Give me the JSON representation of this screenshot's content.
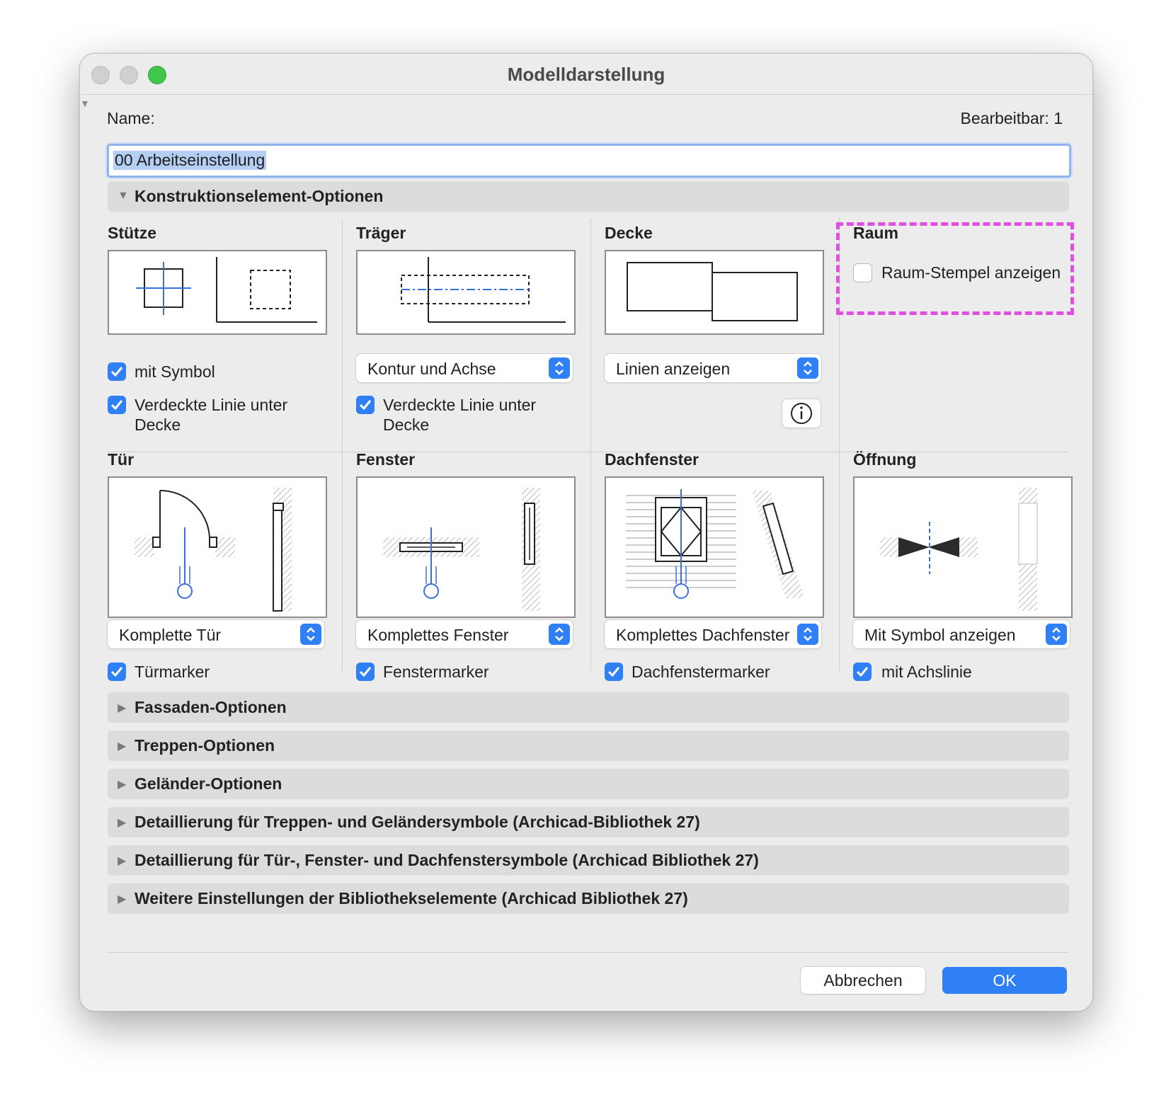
{
  "window": {
    "title": "Modelldarstellung"
  },
  "name_row": {
    "label": "Name:",
    "editable": "Bearbeitbar: 1",
    "value": "00 Arbeitseinstellung"
  },
  "construction": {
    "header": "Konstruktionselement-Optionen",
    "stuetze": {
      "title": "Stütze",
      "cb1": "mit Symbol",
      "cb2_line1": "Verdeckte Linie unter",
      "cb2_line2": "Decke"
    },
    "traeger": {
      "title": "Träger",
      "popup": "Kontur und Achse",
      "cb_line1": "Verdeckte Linie unter",
      "cb_line2": "Decke"
    },
    "decke": {
      "title": "Decke",
      "popup": "Linien anzeigen"
    },
    "raum": {
      "title": "Raum",
      "cb": "Raum-Stempel anzeigen"
    },
    "tuer": {
      "title": "Tür",
      "popup": "Komplette Tür",
      "cb": "Türmarker"
    },
    "fenster": {
      "title": "Fenster",
      "popup": "Komplettes Fenster",
      "cb": "Fenstermarker"
    },
    "dachfenster": {
      "title": "Dachfenster",
      "popup": "Komplettes Dachfenster",
      "cb": "Dachfenstermarker"
    },
    "oeffnung": {
      "title": "Öffnung",
      "popup": "Mit Symbol anzeigen",
      "cb": "mit Achslinie"
    }
  },
  "sections": [
    "Fassaden-Optionen",
    "Treppen-Optionen",
    "Geländer-Optionen",
    "Detaillierung für Treppen- und Geländersymbole (Archicad-Bibliothek 27)",
    "Detaillierung für Tür-, Fenster- und Dachfenstersymbole (Archicad Bibliothek 27)",
    "Weitere Einstellungen der Bibliothekselemente (Archicad Bibliothek 27)"
  ],
  "buttons": {
    "cancel": "Abbrechen",
    "ok": "OK"
  },
  "colors": {
    "accent": "#2f7ff5",
    "highlight": "#e04fe0"
  }
}
